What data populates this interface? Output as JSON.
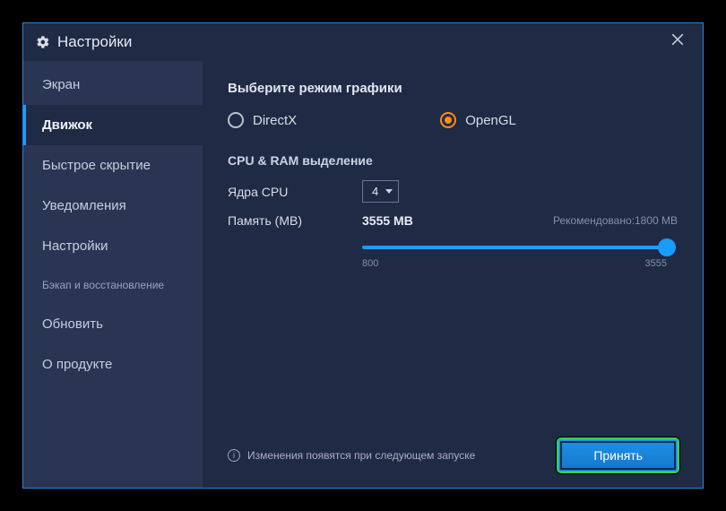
{
  "colors": {
    "accent": "#1a9cff",
    "radio_selected": "#ff8c1a",
    "apply_glow": "#34d24a"
  },
  "titlebar": {
    "title": "Настройки"
  },
  "sidebar": {
    "items": [
      {
        "label": "Экран",
        "active": false
      },
      {
        "label": "Движок",
        "active": true
      },
      {
        "label": "Быстрое скрытие",
        "active": false
      },
      {
        "label": "Уведомления",
        "active": false
      },
      {
        "label": "Настройки",
        "active": false
      },
      {
        "label": "Бэкап и восстановление",
        "active": false,
        "small": true
      },
      {
        "label": "Обновить",
        "active": false
      },
      {
        "label": "О продукте",
        "active": false
      }
    ]
  },
  "content": {
    "graphics_mode": {
      "title": "Выберите режим графики",
      "options": [
        {
          "label": "DirectX",
          "selected": false
        },
        {
          "label": "OpenGL",
          "selected": true
        }
      ]
    },
    "cpu_ram": {
      "title": "CPU & RAM выделение",
      "cpu_label": "Ядра CPU",
      "cpu_value": "4",
      "mem_label": "Память (MB)",
      "mem_value": "3555 MB",
      "recommended_label": "Рекомендовано:1800 MB",
      "slider": {
        "min_label": "800",
        "max_label": "3555",
        "min": 800,
        "max": 3555,
        "value": 3555
      }
    },
    "footer": {
      "notice": "Изменения появятся при следующем запуске",
      "accept": "Принять"
    }
  }
}
